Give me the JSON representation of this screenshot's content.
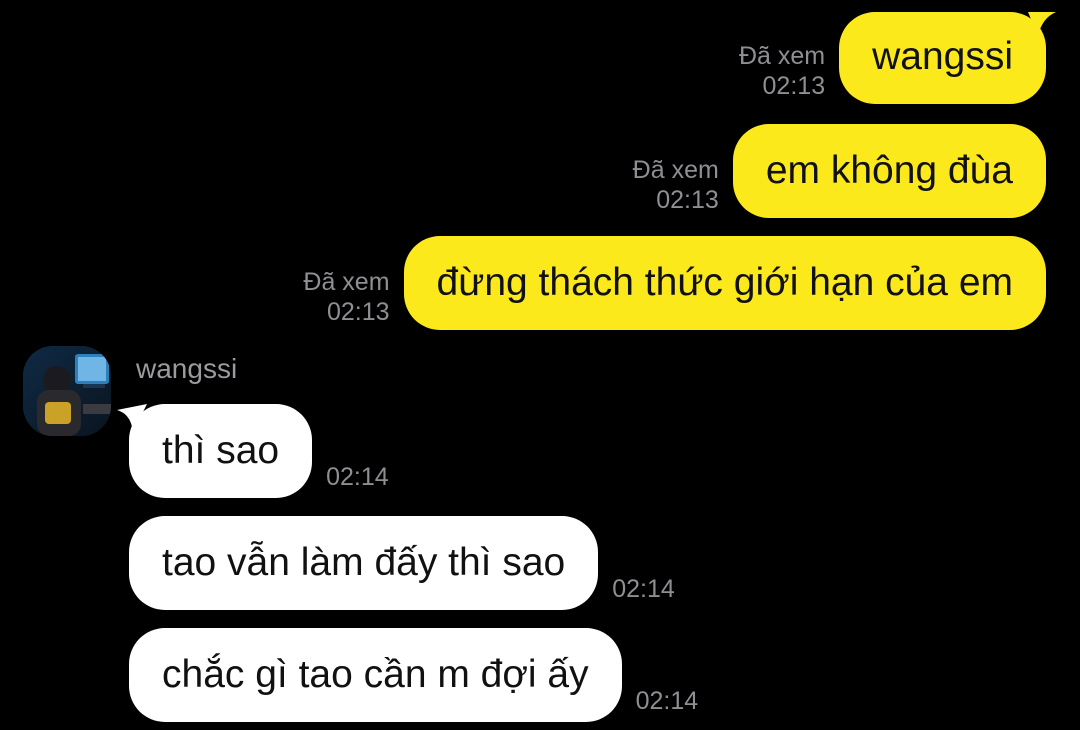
{
  "sent_messages": [
    {
      "text": "wangssi",
      "status": "Đã xem",
      "time": "02:13"
    },
    {
      "text": "em không đùa",
      "status": "Đã xem",
      "time": "02:13"
    },
    {
      "text": "đừng thách thức giới hạn của em",
      "status": "Đã xem",
      "time": "02:13"
    }
  ],
  "sender": {
    "name": "wangssi",
    "avatar_icon": "avatar-photo-gamer"
  },
  "received_messages": [
    {
      "text": "thì sao",
      "time": "02:14"
    },
    {
      "text": "tao vẫn làm đấy thì sao",
      "time": "02:14"
    },
    {
      "text": "chắc gì tao cần m đợi ấy",
      "time": "02:14"
    }
  ],
  "colors": {
    "background": "#000000",
    "sent_bubble": "#fce91b",
    "received_bubble": "#ffffff",
    "meta_text": "#8e8e93"
  }
}
